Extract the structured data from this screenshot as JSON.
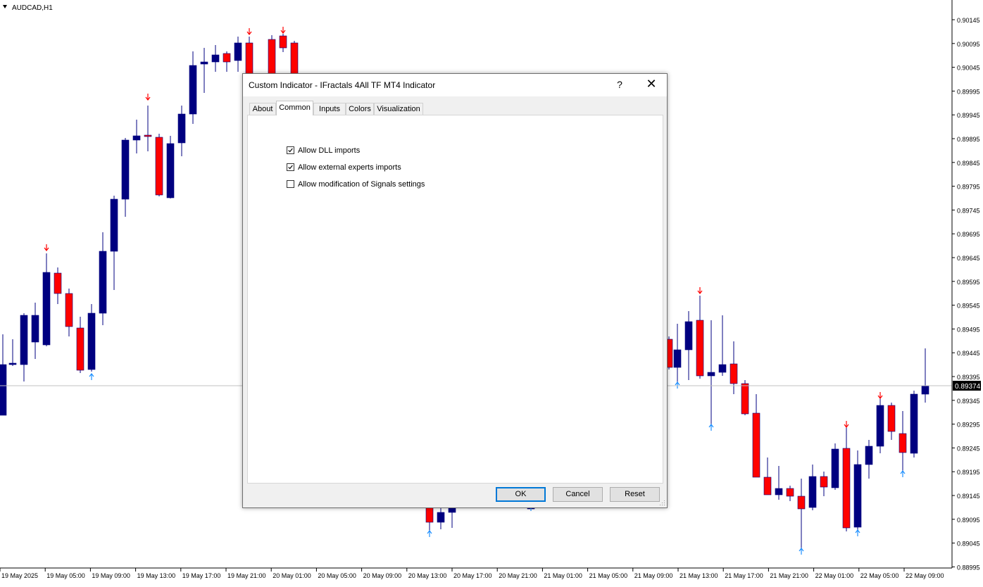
{
  "chart": {
    "symbol_label": "AUDCAD,H1",
    "current_price": "0.89374",
    "colors": {
      "bull": "#000080",
      "bear": "#ff0000",
      "fractal_up": "#ff0000",
      "fractal_down": "#1e90ff",
      "grid_line": "#c0c0c0"
    },
    "price_ticks": [
      "0.90145",
      "0.90095",
      "0.90045",
      "0.89995",
      "0.89945",
      "0.89895",
      "0.89845",
      "0.89795",
      "0.89745",
      "0.89695",
      "0.89645",
      "0.89595",
      "0.89545",
      "0.89495",
      "0.89445",
      "0.89395",
      "0.89345",
      "0.89295",
      "0.89245",
      "0.89195",
      "0.89145",
      "0.89095",
      "0.89045",
      "0.88995"
    ],
    "time_ticks": [
      "19 May 2025",
      "19 May 05:00",
      "19 May 09:00",
      "19 May 13:00",
      "19 May 17:00",
      "19 May 21:00",
      "20 May 01:00",
      "20 May 05:00",
      "20 May 09:00",
      "20 May 13:00",
      "20 May 17:00",
      "20 May 21:00",
      "21 May 01:00",
      "21 May 05:00",
      "21 May 09:00",
      "21 May 13:00",
      "21 May 17:00",
      "21 May 21:00",
      "22 May 01:00",
      "22 May 05:00",
      "22 May 09:00"
    ]
  },
  "dialog": {
    "title": "Custom Indicator - IFractals 4All TF MT4 Indicator",
    "help": "?",
    "close": "✕",
    "tabs": [
      "About",
      "Common",
      "Inputs",
      "Colors",
      "Visualization"
    ],
    "active_tab": "Common",
    "options": [
      {
        "label": "Allow DLL imports",
        "checked": true
      },
      {
        "label": "Allow external experts imports",
        "checked": true
      },
      {
        "label": "Allow modification of Signals settings",
        "checked": false
      }
    ],
    "buttons": {
      "ok": "OK",
      "cancel": "Cancel",
      "reset": "Reset"
    }
  }
}
